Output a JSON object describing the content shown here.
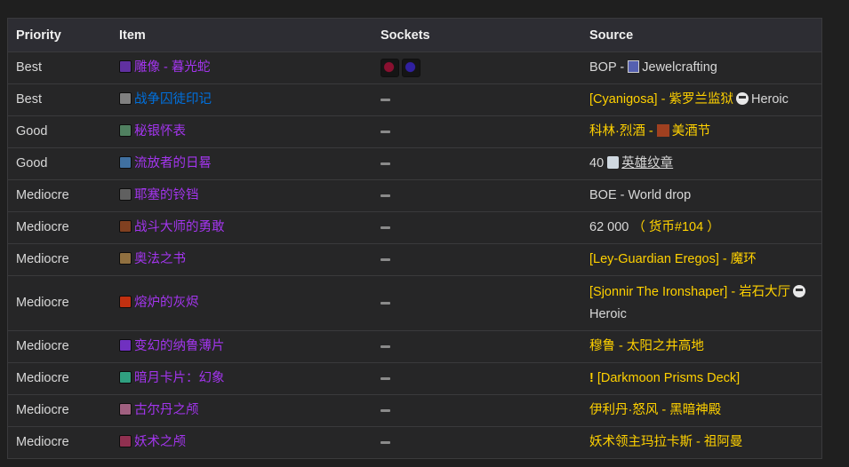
{
  "headers": {
    "priority": "Priority",
    "item": "Item",
    "sockets": "Sockets",
    "source": "Source"
  },
  "colors": {
    "epic": "#a335ee",
    "rare": "#0070dd",
    "source_link": "#ffd100"
  },
  "rows": [
    {
      "priority": "Best",
      "item": "雕像 - 暮光蛇",
      "quality": "epic",
      "icon": "serpent-statue-icon",
      "icon_color": "#6030a0",
      "sockets": [
        {
          "name": "red-socket-icon",
          "color": "#8a1030"
        },
        {
          "name": "blue-socket-icon",
          "color": "#3020a0"
        }
      ],
      "source": {
        "prefix": "BOP - ",
        "prof_icon": "jewelcrafting-icon",
        "link": "Jewelcrafting"
      }
    },
    {
      "priority": "Best",
      "item": "战争囚徒印记",
      "quality": "rare",
      "icon": "war-prisoner-icon",
      "icon_color": "#808080",
      "source": {
        "boss": "[Cyanigosa]",
        "sep": " - ",
        "zone": "紫罗兰监狱",
        "difficulty": "Heroic"
      }
    },
    {
      "priority": "Good",
      "item": "秘银怀表",
      "quality": "epic",
      "icon": "mithril-watch-icon",
      "icon_color": "#508060",
      "source": {
        "boss": "科林·烈酒",
        "sep": " - ",
        "zone": "美酒节"
      }
    },
    {
      "priority": "Good",
      "item": "流放者的日晷",
      "quality": "epic",
      "icon": "sundial-icon",
      "icon_color": "#4070a0",
      "source": {
        "amount": "40",
        "currency": "英雄纹章"
      }
    },
    {
      "priority": "Mediocre",
      "item": "耶塞的铃铛",
      "quality": "epic",
      "icon": "bell-icon",
      "icon_color": "#606060",
      "source": {
        "text": "BOE - World drop"
      }
    },
    {
      "priority": "Mediocre",
      "item": "战斗大师的勇敢",
      "quality": "epic",
      "icon": "battlemaster-icon",
      "icon_color": "#804020",
      "source": {
        "amount": "62 000",
        "currency": "（ 货币#104 ）"
      }
    },
    {
      "priority": "Mediocre",
      "item": "奥法之书",
      "quality": "epic",
      "icon": "arcane-book-icon",
      "icon_color": "#907040",
      "source": {
        "boss": "[Ley-Guardian Eregos]",
        "sep": " - ",
        "zone": "魔环"
      }
    },
    {
      "priority": "Mediocre",
      "item": "熔炉的灰烬",
      "quality": "epic",
      "icon": "forge-ember-icon",
      "icon_color": "#c03010",
      "tall": true,
      "source": {
        "boss": "[Sjonnir The Ironshaper]",
        "sep": " - ",
        "zone": "岩石大厅",
        "difficulty": "Heroic"
      }
    },
    {
      "priority": "Mediocre",
      "item": "变幻的纳鲁薄片",
      "quality": "epic",
      "icon": "naaru-sliver-icon",
      "icon_color": "#7030c0",
      "source": {
        "boss": "穆鲁",
        "sep": " - ",
        "zone": "太阳之井高地"
      }
    },
    {
      "priority": "Mediocre",
      "item": "暗月卡片：幻象",
      "quality": "epic",
      "icon": "darkmoon-card-icon",
      "icon_color": "#30a080",
      "source": {
        "quest": "[Darkmoon Prisms Deck]"
      }
    },
    {
      "priority": "Mediocre",
      "item": "古尔丹之颅",
      "quality": "epic",
      "icon": "skull-of-guldan-icon",
      "icon_color": "#a06080",
      "source": {
        "boss": "伊利丹·怒风",
        "sep": " - ",
        "zone": "黑暗神殿"
      }
    },
    {
      "priority": "Mediocre",
      "item": "妖术之颅",
      "quality": "epic",
      "icon": "hex-skull-icon",
      "icon_color": "#903050",
      "source": {
        "boss": "妖术领主玛拉卡斯",
        "sep": " - ",
        "zone": "祖阿曼"
      }
    }
  ]
}
